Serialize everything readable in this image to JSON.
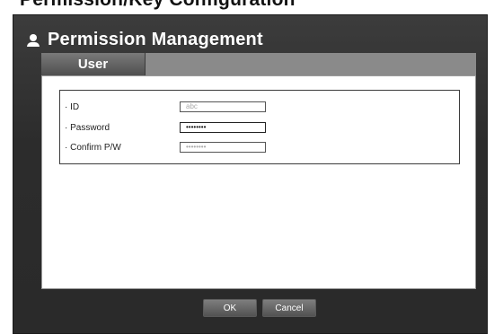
{
  "page_top_text": "Permission/Key Configuration",
  "dialog": {
    "title": "Permission Management",
    "title_icon": "user-icon"
  },
  "tabs": [
    {
      "label": "User",
      "selected": true
    }
  ],
  "fields": {
    "id": {
      "label": "· ID",
      "value": "abc"
    },
    "password": {
      "label": "· Password",
      "value": "••••••••"
    },
    "confirm": {
      "label": "· Confirm P/W",
      "value": "••••••••"
    }
  },
  "buttons": {
    "ok": "OK",
    "cancel": "Cancel"
  }
}
